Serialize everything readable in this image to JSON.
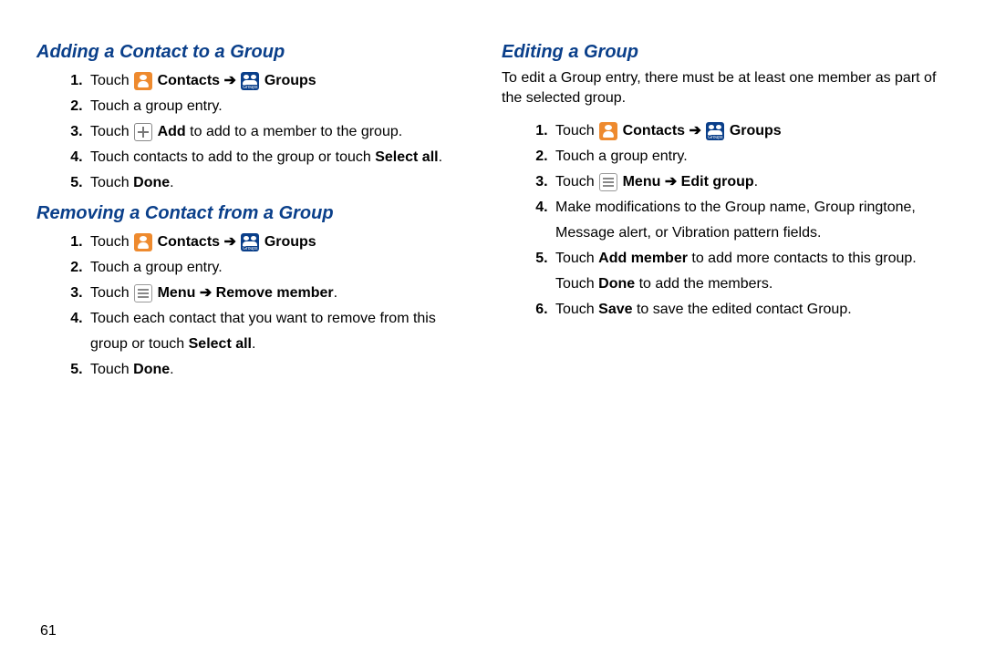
{
  "page_number": "61",
  "arrow": "➔",
  "icons": {
    "contacts_label": "Contacts",
    "groups_label": "Groups",
    "menu_label": "Menu",
    "add_label": "Add"
  },
  "left": {
    "section_a": {
      "heading": "Adding a Contact to a Group",
      "steps": {
        "s1_pre": "Touch ",
        "s1_mid": " ",
        "s2": "Touch a group entry.",
        "s3_pre": "Touch ",
        "s3_post": " to add to a member to the group.",
        "s4_pre": "Touch contacts to add to the group or touch ",
        "s4_bold": "Select all",
        "s4_post": ".",
        "s5_pre": "Touch ",
        "s5_bold": "Done",
        "s5_post": "."
      }
    },
    "section_b": {
      "heading": "Removing a Contact from a Group",
      "steps": {
        "s1_pre": "Touch ",
        "s2": "Touch a group entry.",
        "s3_pre": "Touch ",
        "s3_bold": " Remove member",
        "s3_post": ".",
        "s4_pre": "Touch each contact that you want to remove from this group or touch ",
        "s4_bold": "Select all",
        "s4_post": ".",
        "s5_pre": "Touch ",
        "s5_bold": "Done",
        "s5_post": "."
      }
    }
  },
  "right": {
    "section_c": {
      "heading": "Editing a Group",
      "intro": "To edit a Group entry, there must be at least one member as part of the selected group.",
      "steps": {
        "s1_pre": "Touch ",
        "s2": "Touch a group entry.",
        "s3_pre": "Touch ",
        "s3_bold": " Edit group",
        "s3_post": ".",
        "s4": "Make modifications to the Group name, Group ringtone, Message alert, or Vibration pattern fields.",
        "s5_pre": "Touch ",
        "s5_bold1": "Add member",
        "s5_mid": " to add more contacts to this group. Touch ",
        "s5_bold2": "Done",
        "s5_post": " to add the members.",
        "s6_pre": "Touch ",
        "s6_bold": "Save",
        "s6_post": " to save the edited contact Group."
      }
    }
  }
}
